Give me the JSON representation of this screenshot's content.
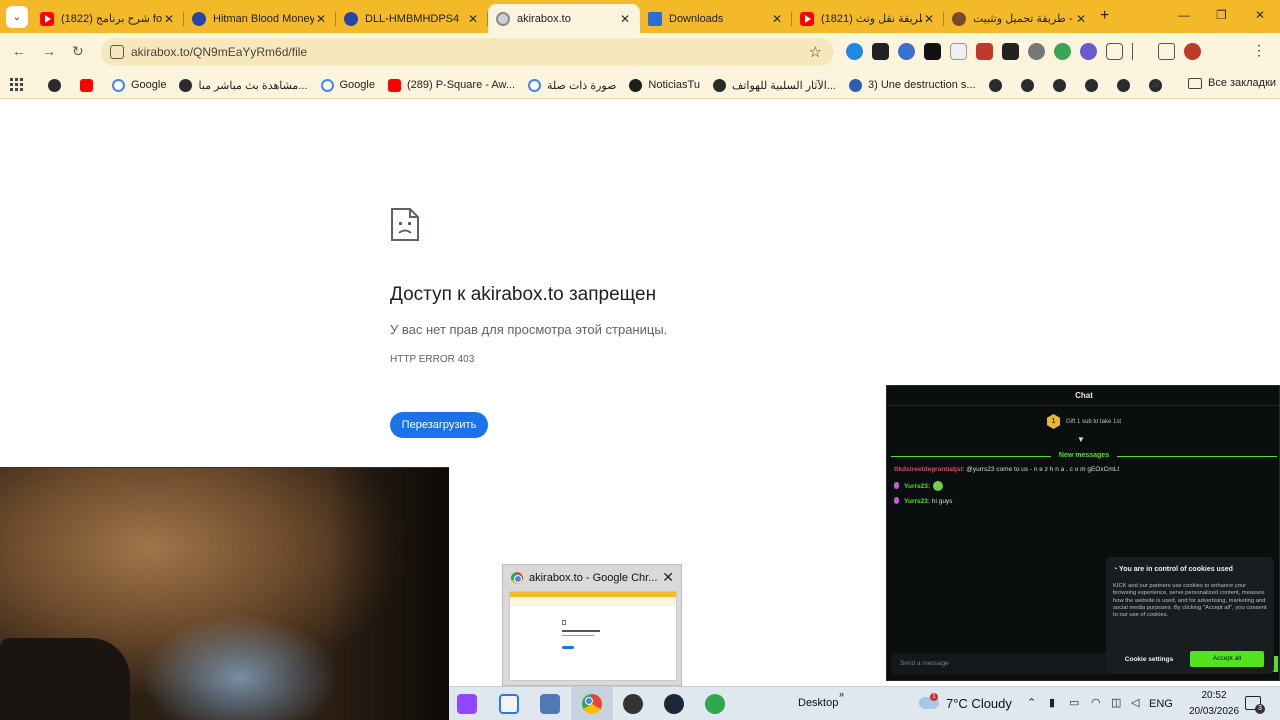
{
  "tabs": [
    {
      "title": "(1822) شرح برنامج fox",
      "icon": "youtube-icon",
      "active": false
    },
    {
      "title": "Hitman Blood Money",
      "icon": "site-icon",
      "active": false
    },
    {
      "title": "DLL-HMBMHDPS4",
      "icon": "site-icon",
      "active": false
    },
    {
      "title": "akirabox.to",
      "icon": "globe-icon",
      "active": true
    },
    {
      "title": "Downloads",
      "icon": "downloads-icon",
      "active": false
    },
    {
      "title": "(1821) طريقة نقل وتث",
      "icon": "youtube-icon",
      "active": false
    },
    {
      "title": "طريقة تحميل وتثبيت -",
      "icon": "avatar-icon",
      "active": false
    }
  ],
  "toolbar": {
    "url": "akirabox.to/QN9mEaYyRm6d/file",
    "new_tab": "+",
    "back": "←",
    "forward": "→",
    "reload": "↻",
    "star": "☆",
    "menu": "⋮",
    "minimize": "—",
    "maximize": "❐",
    "close": "✕",
    "tab_menu": "⌄"
  },
  "bookmarks": [
    {
      "label": "",
      "icon": "globe-icon"
    },
    {
      "label": "",
      "icon": "youtube-icon"
    },
    {
      "label": "Google",
      "icon": "google-icon"
    },
    {
      "label": "مشاهدة بث مباشر مبا...",
      "icon": "globe-icon"
    },
    {
      "label": "Google",
      "icon": "google-icon"
    },
    {
      "label": "(289) P-Square - Aw...",
      "icon": "youtube-icon"
    },
    {
      "label": "صورة ذات صلة",
      "icon": "google-icon"
    },
    {
      "label": "NoticiasTu",
      "icon": "notion-icon"
    },
    {
      "label": "الآثار السلبية للهواتف...",
      "icon": "globe-icon"
    },
    {
      "label": "3) Une destruction s...",
      "icon": "wordpress-icon"
    },
    {
      "label": "",
      "icon": "globe-icon"
    },
    {
      "label": "",
      "icon": "globe-icon"
    },
    {
      "label": "",
      "icon": "globe-icon"
    },
    {
      "label": "",
      "icon": "globe-icon"
    },
    {
      "label": "",
      "icon": "globe-icon"
    },
    {
      "label": "",
      "icon": "globe-icon"
    },
    {
      "label": "",
      "icon": "globe-icon"
    }
  ],
  "bookmarks_more": "»",
  "bookmarks_all": "Все закладки",
  "error_page": {
    "title": "Доступ к akirabox.to запрещен",
    "description": "У вас нет прав для просмотра этой страницы.",
    "code": "HTTP ERROR 403",
    "reload_label": "Перезагрузить"
  },
  "chat": {
    "header": "Chat",
    "gift_text": "Gift 1 sub to take 1st",
    "gift_rank": "1",
    "new_messages_label": "New messages",
    "messages": [
      {
        "user": "ttkdstreetdegrantiatjst",
        "text": ": @yurrs23 come to us - n e z h n a . c o m gEOxCmLt",
        "user_color": "#e8435b"
      },
      {
        "user": "Yurrs23:",
        "text": "",
        "user_color": "#52e51f"
      },
      {
        "user": "Yurrs23:",
        "text": " hi guys",
        "user_color": "#52e51f"
      }
    ],
    "send_placeholder": "Send a message"
  },
  "cookie_banner": {
    "title": "You are in control of cookies used",
    "text": "KICK and our partners use cookies to enhance your browsing experience, serve personalized content, measure how the website is used, and for advertising, marketing and social media purposes. By clicking \"Accept all\", you consent to our use of cookies.",
    "settings_label": "Cookie settings",
    "accept_label": "Accept all"
  },
  "taskbar_preview": {
    "title": "akirabox.to - Google Chr...",
    "close": "✕"
  },
  "taskbar": {
    "desktop_label": "Desktop",
    "desktop_chevron": "»",
    "weather": "7°C  Cloudy",
    "weather_badge": "1",
    "language": "ENG",
    "time": "20:52",
    "date": "20/03/2026",
    "notification_count": "3"
  },
  "colors": {
    "tabstrip": "#f4b928",
    "toolbar": "#fdf4dd",
    "accent_blue": "#1a73e8",
    "kick_green": "#52e51f"
  }
}
